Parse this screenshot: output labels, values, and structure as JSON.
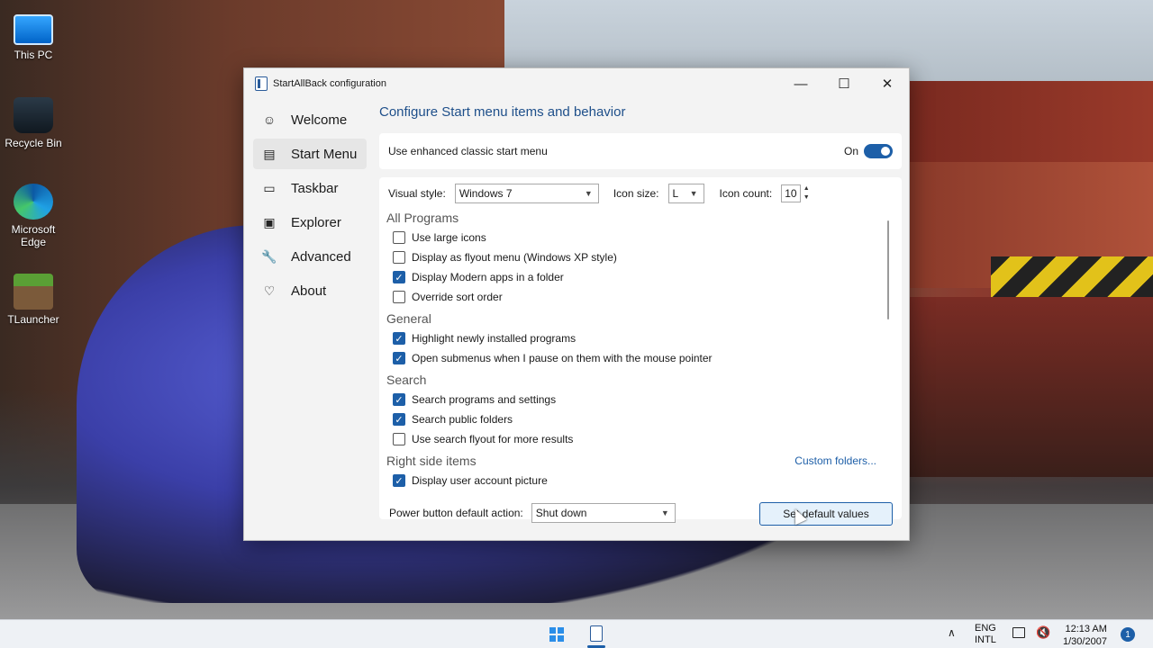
{
  "desktop": {
    "icons": [
      {
        "label": "This PC",
        "icon": "computer-icon"
      },
      {
        "label": "Recycle Bin",
        "icon": "recycle-bin-icon"
      },
      {
        "label": "Microsoft Edge",
        "icon": "edge-icon"
      },
      {
        "label": "TLauncher",
        "icon": "tlauncher-icon"
      }
    ]
  },
  "window": {
    "title": "StartAllBack configuration",
    "controls": {
      "minimize": "—",
      "maximize": "☐",
      "close": "✕"
    }
  },
  "sidebar": {
    "items": [
      {
        "label": "Welcome",
        "icon": "☺",
        "active": false
      },
      {
        "label": "Start Menu",
        "icon": "▤",
        "active": true
      },
      {
        "label": "Taskbar",
        "icon": "▭",
        "active": false
      },
      {
        "label": "Explorer",
        "icon": "▣",
        "active": false
      },
      {
        "label": "Advanced",
        "icon": "🔧",
        "active": false
      },
      {
        "label": "About",
        "icon": "♡",
        "active": false
      }
    ]
  },
  "main": {
    "title": "Configure Start menu items and behavior",
    "enhanced": {
      "label": "Use enhanced classic start menu",
      "state_label": "On",
      "enabled": true
    },
    "visual_style": {
      "label": "Visual style:",
      "value": "Windows 7"
    },
    "icon_size": {
      "label": "Icon size:",
      "value": "L"
    },
    "icon_count": {
      "label": "Icon count:",
      "value": "10"
    },
    "sections": {
      "all_programs": {
        "title": "All Programs",
        "items": [
          {
            "label": "Use large icons",
            "checked": false
          },
          {
            "label": "Display as flyout menu (Windows XP style)",
            "checked": false
          },
          {
            "label": "Display Modern apps in a folder",
            "checked": true
          },
          {
            "label": "Override sort order",
            "checked": false
          }
        ]
      },
      "general": {
        "title": "General",
        "items": [
          {
            "label": "Highlight newly installed programs",
            "checked": true
          },
          {
            "label": "Open submenus when I pause on them with the mouse pointer",
            "checked": true
          }
        ]
      },
      "search": {
        "title": "Search",
        "items": [
          {
            "label": "Search programs and settings",
            "checked": true
          },
          {
            "label": "Search public folders",
            "checked": true
          },
          {
            "label": "Use search flyout for more results",
            "checked": false
          }
        ]
      },
      "right_side": {
        "title": "Right side items",
        "link": "Custom folders...",
        "items": [
          {
            "label": "Display user account picture",
            "checked": true
          }
        ]
      }
    },
    "power": {
      "label": "Power button default action:",
      "value": "Shut down"
    },
    "default_button": "Set default values"
  },
  "taskbar": {
    "lang_top": "ENG",
    "lang_bottom": "INTL",
    "time": "12:13 AM",
    "date": "1/30/2007",
    "notification_count": "1"
  },
  "colors": {
    "accent": "#1d5fa8",
    "link": "#1e5fa8"
  }
}
